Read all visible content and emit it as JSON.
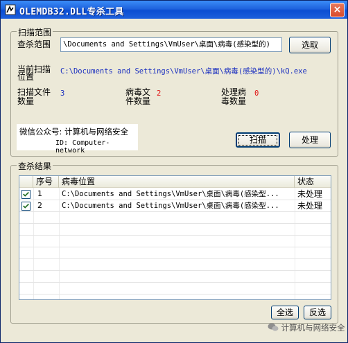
{
  "window": {
    "title": "OLEMDB32.DLL专杀工具",
    "close_glyph": "×"
  },
  "scan_range": {
    "group_title": "扫描范围",
    "scope_label": "查杀范围",
    "scope_value": "\\Documents and Settings\\VmUser\\桌面\\病毒(感染型的)",
    "browse_button": "选取",
    "current_label": "当前扫描\n位置",
    "current_value": "C:\\Documents and Settings\\VmUser\\桌面\\病毒(感染型的)\\kQ.exe",
    "stats": [
      {
        "label": "扫描文件\n数量",
        "value": "3"
      },
      {
        "label": "病毒文\n件数量",
        "value": "2"
      },
      {
        "label": "处理病\n毒数量",
        "value": "0"
      }
    ],
    "wechat_line": "微信公众号: 计算机与网络安全",
    "id_line": "ID: Computer-network",
    "scan_button": "扫描",
    "process_button": "处理"
  },
  "results": {
    "group_title": "查杀结果",
    "columns": [
      "序号",
      "病毒位置",
      "状态"
    ],
    "rows": [
      {
        "checked": true,
        "index": "1",
        "location": "C:\\Documents and Settings\\VmUser\\桌面\\病毒(感染型...",
        "status": "未处理"
      },
      {
        "checked": true,
        "index": "2",
        "location": "C:\\Documents and Settings\\VmUser\\桌面\\病毒(感染型...",
        "status": "未处理"
      }
    ],
    "select_all_button": "全选",
    "invert_button": "反选"
  },
  "footer_logo": "计算机与网络安全",
  "colors": {
    "title_bar": "#1f63de",
    "path_blue": "#1a2fbf",
    "count_red": "#e01010",
    "face": "#ece9d8"
  }
}
